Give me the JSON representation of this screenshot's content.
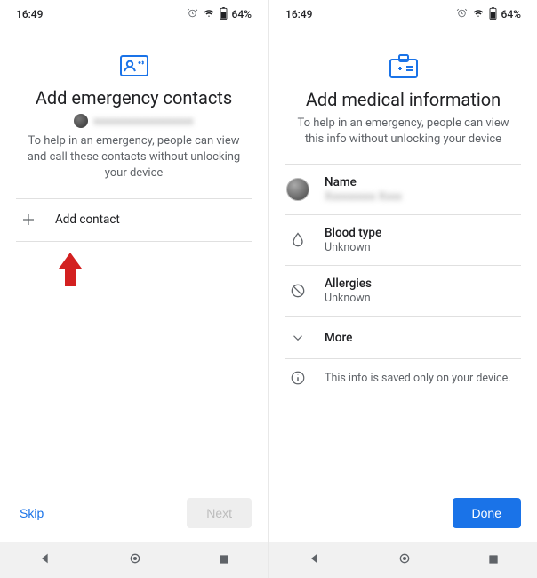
{
  "status": {
    "time": "16:49",
    "battery": "64%"
  },
  "left": {
    "title": "Add emergency contacts",
    "account_email_obscured": "xxxxxxxxxxxxxxxxxx",
    "subtitle": "To help in an emergency, people can view and call these contacts without unlocking your device",
    "add_contact_label": "Add contact",
    "skip_label": "Skip",
    "next_label": "Next"
  },
  "right": {
    "title": "Add medical information",
    "subtitle": "To help in an emergency, people can view this info without unlocking your device",
    "name_label": "Name",
    "name_value_obscured": "Xxxxxxxxx Xxxx",
    "blood_label": "Blood type",
    "blood_value": "Unknown",
    "allergies_label": "Allergies",
    "allergies_value": "Unknown",
    "more_label": "More",
    "info_text": "This info is saved only on your device.",
    "done_label": "Done"
  },
  "colors": {
    "primary": "#1a73e8",
    "text": "#202124",
    "muted": "#5f6368",
    "annotation": "#d32020"
  }
}
